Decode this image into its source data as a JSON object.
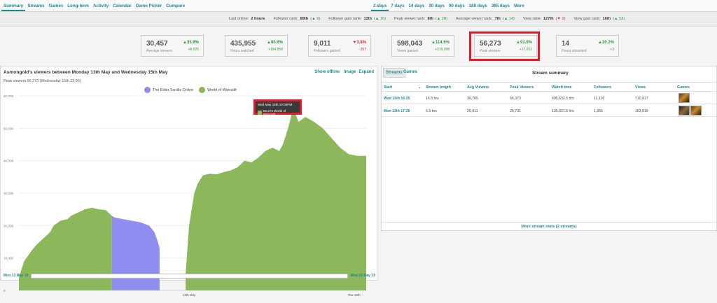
{
  "nav": {
    "tabs": [
      "Summary",
      "Streams",
      "Games",
      "Long-term",
      "Activity",
      "Calendar",
      "Game Picker",
      "Compare"
    ],
    "active_tab": "Summary",
    "ranges": [
      "3 days",
      "7 days",
      "14 days",
      "30 days",
      "90 days",
      "180 days",
      "365 days",
      "More"
    ],
    "active_range": "3 days"
  },
  "ranks": [
    {
      "label": "Last online:",
      "value": "2 hours",
      "delta": "",
      "dir": ""
    },
    {
      "label": "Follower rank:",
      "value": "89th",
      "delta": "9",
      "dir": "up"
    },
    {
      "label": "Follower gain rank:",
      "value": "12th",
      "delta": "15",
      "dir": "up"
    },
    {
      "label": "Peak viewer rank:",
      "value": "8th",
      "delta": "28",
      "dir": "up"
    },
    {
      "label": "Average viewer rank:",
      "value": "7th",
      "delta": "14",
      "dir": "up"
    },
    {
      "label": "View rank:",
      "value": "127th",
      "delta": "2",
      "dir": "down"
    },
    {
      "label": "View gain rank:",
      "value": "16th",
      "delta": "53",
      "dir": "up"
    }
  ],
  "stats": [
    {
      "value": "30,457",
      "label": "Average viewers",
      "pct": "35.8%",
      "abs": "+8,025",
      "neg": false
    },
    {
      "value": "435,955",
      "label": "Hours watched",
      "pct": "80.6%",
      "abs": "+194,558",
      "neg": false
    },
    {
      "value": "9,011",
      "label": "Followers gained",
      "pct": "3.8%",
      "abs": "-357",
      "neg": true
    },
    {
      "value": "598,043",
      "label": "Views gained",
      "pct": "114.6%",
      "abs": "+319,398",
      "neg": false
    },
    {
      "value": "56,273",
      "label": "Peak viewers",
      "pct": "93.9%",
      "abs": "+27,252",
      "neg": false
    },
    {
      "value": "14",
      "label": "Hours streamed",
      "pct": "30.2%",
      "abs": "+3",
      "neg": false
    }
  ],
  "chart_panel": {
    "title": "Asmongold's viewers between Monday 13th May and Wednesday 15th May",
    "show_offline": "Show offline",
    "image": "Image",
    "expand": "Expand",
    "subtitle": "Peak viewers 56,273 (Wednesday 15th 22:00)",
    "tooltip_title": "Wed May 15th 10:00PM",
    "tooltip_value": "56,273 World of Warcraft",
    "nav_start": "Mon 13 May 19",
    "nav_end": "Wed 15 May 19"
  },
  "chart_data": {
    "type": "area",
    "title": "",
    "xlabel": "",
    "ylabel": "",
    "ylim": [
      0,
      60000
    ],
    "yticks": [
      "0",
      "10,000",
      "20,000",
      "30,000",
      "40,000",
      "50,000",
      "60,000"
    ],
    "xticks": [
      "14th May",
      "Thu 16th"
    ],
    "legend_position": "top-center",
    "series": [
      {
        "name": "The Elder Scrolls Online",
        "color": "#8f8ef0",
        "points": [
          [
            0.535,
            23000
          ],
          [
            0.55,
            22500
          ],
          [
            0.6,
            22000
          ],
          [
            0.65,
            21500
          ],
          [
            0.7,
            21000
          ],
          [
            0.75,
            20000
          ],
          [
            0.78,
            18000
          ],
          [
            0.8,
            15000
          ],
          [
            0.81,
            13000
          ]
        ]
      },
      {
        "name": "World of Warcraft",
        "color": "#8ab85a",
        "points": [
          [
            0.0,
            4000
          ],
          [
            0.03,
            9000
          ],
          [
            0.07,
            12000
          ],
          [
            0.1,
            14000
          ],
          [
            0.14,
            16000
          ],
          [
            0.18,
            18000
          ],
          [
            0.2,
            20000
          ],
          [
            0.24,
            21500
          ],
          [
            0.28,
            22000
          ],
          [
            0.3,
            23000
          ],
          [
            0.34,
            24000
          ],
          [
            0.38,
            25000
          ],
          [
            0.42,
            25500
          ],
          [
            0.46,
            25000
          ],
          [
            0.5,
            24800
          ],
          [
            0.535,
            23000
          ]
        ]
      },
      {
        "name": "World of Warcraft",
        "color": "#8ab85a",
        "points": [
          [
            0.96,
            5000
          ],
          [
            0.98,
            20000
          ],
          [
            1.01,
            30000
          ],
          [
            1.03,
            33000
          ],
          [
            1.06,
            35500
          ],
          [
            1.1,
            36000
          ],
          [
            1.14,
            35800
          ],
          [
            1.18,
            36500
          ],
          [
            1.22,
            37000
          ],
          [
            1.26,
            38000
          ],
          [
            1.3,
            40000
          ],
          [
            1.34,
            39500
          ],
          [
            1.38,
            41000
          ],
          [
            1.42,
            43000
          ],
          [
            1.46,
            44000
          ],
          [
            1.5,
            43000
          ],
          [
            1.52,
            45000
          ],
          [
            1.55,
            50000
          ],
          [
            1.58,
            56273
          ],
          [
            1.61,
            52000
          ],
          [
            1.65,
            53500
          ],
          [
            1.7,
            52000
          ],
          [
            1.75,
            50000
          ],
          [
            1.8,
            47000
          ],
          [
            1.85,
            44000
          ],
          [
            1.9,
            42000
          ],
          [
            1.95,
            41500
          ],
          [
            2.0,
            41500
          ]
        ]
      }
    ]
  },
  "streams_panel": {
    "tabs": [
      "Streams",
      "Games"
    ],
    "title": "Stream summary",
    "columns": [
      "Start",
      "Stream length",
      "Avg Viewers",
      "Peak Viewers",
      "Watch time",
      "Followers",
      "Views",
      "Games"
    ],
    "rows": [
      {
        "start": "Wed 15th 16:25",
        "length": "16.5 hrs",
        "avg": "36,705",
        "peak": "56,273",
        "watch": "605,632.5 hrs",
        "followers": "11,102",
        "views": "710,917",
        "games": [
          "wow"
        ]
      },
      {
        "start": "Mon 13th 17:26",
        "length": "6.5 hrs",
        "avg": "20,911",
        "peak": "26,731",
        "watch": "135,921.5 hrs",
        "followers": "1,355",
        "views": "153,019",
        "games": [
          "eso",
          "wow"
        ]
      }
    ],
    "more": "More stream stats (2 streams)"
  },
  "colors": {
    "accent": "#1a8a93",
    "highlight": "#e21d2a",
    "wow": "#8ab85a",
    "eso": "#8f8ef0"
  }
}
